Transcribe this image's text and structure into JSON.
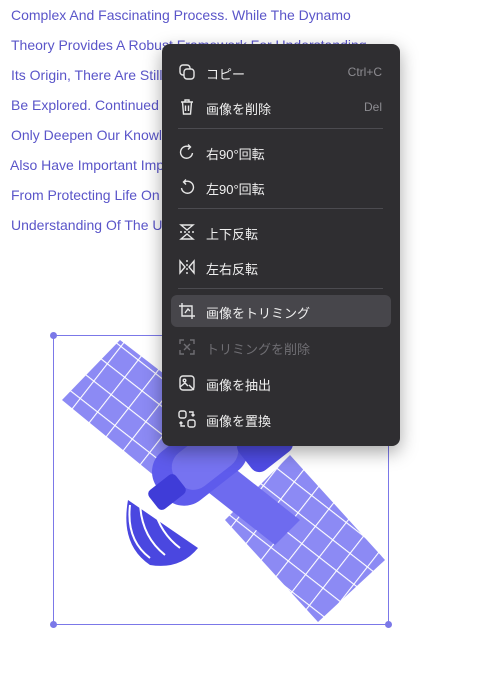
{
  "document": {
    "lines": [
      "Complex And Fascinating Process. While The Dynamo",
      "Theory Provides A Robust Framework For Understanding",
      "Its Origin, There Are Still",
      "Be Explored. Continued",
      "Only Deepen Our Knowl",
      "Also Have Important Imp",
      "From Protecting Life On",
      "Understanding Of The U"
    ]
  },
  "context_menu": {
    "items": [
      {
        "label": "コピー",
        "shortcut": "Ctrl+C",
        "icon": "copy-icon"
      },
      {
        "label": "画像を削除",
        "shortcut": "Del",
        "icon": "trash-icon"
      },
      {
        "label": "右90°回転",
        "icon": "rotate-right-icon"
      },
      {
        "label": "左90°回転",
        "icon": "rotate-left-icon"
      },
      {
        "label": "上下反転",
        "icon": "flip-vertical-icon"
      },
      {
        "label": "左右反転",
        "icon": "flip-horizontal-icon"
      },
      {
        "label": "画像をトリミング",
        "icon": "crop-icon",
        "state": "hovered"
      },
      {
        "label": "トリミングを削除",
        "icon": "remove-crop-icon",
        "state": "disabled"
      },
      {
        "label": "画像を抽出",
        "icon": "extract-image-icon"
      },
      {
        "label": "画像を置換",
        "icon": "replace-image-icon"
      }
    ]
  },
  "colors": {
    "text_accent": "#5a55c9",
    "selection": "#7b78e8",
    "menu_bg": "#2f2e31"
  }
}
